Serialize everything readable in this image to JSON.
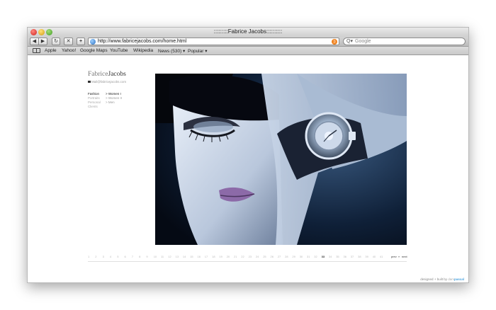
{
  "window": {
    "title": ":::::::::Fabrice Jacobs::::::::::"
  },
  "toolbar": {
    "back_glyph": "◀",
    "forward_glyph": "▶",
    "reload_glyph": "↻",
    "tabs_glyph": "✕",
    "add_glyph": "+",
    "url": "http://www.fabricejacobs.com/home.html",
    "search_placeholder": "Google",
    "search_icon": "Q▾"
  },
  "bookmarks": [
    "Apple",
    "Yahoo!",
    "Google Maps",
    "YouTube",
    "Wikipedia",
    "News (530) ▾",
    "Popular ▾"
  ],
  "site": {
    "logo_first": "Fabrice",
    "logo_second": "Jacobs",
    "email": "Mail@fabricejacobs.com",
    "nav_main": [
      "Fashion",
      "Portraits",
      "Personal",
      "Clients"
    ],
    "nav_sub": [
      "> Women I",
      "> Women II",
      "> Men"
    ],
    "pager": {
      "numbers": [
        "1",
        "2",
        "3",
        "4",
        "5",
        "6",
        "7",
        "8",
        "9",
        "10",
        "11",
        "12",
        "13",
        "14",
        "15",
        "16",
        "17",
        "18",
        "19",
        "20",
        "21",
        "22",
        "23",
        "24",
        "25",
        "26",
        "27",
        "28",
        "29",
        "30",
        "31",
        "32",
        "33",
        "34",
        "35",
        "36",
        "37",
        "38",
        "39",
        "40",
        "41"
      ],
      "current": "33",
      "prev": "prev",
      "sep": "»",
      "next": "next"
    },
    "footer": {
      "prefix": "designed + built by",
      "brand1": "dam",
      "brand2": "pascal"
    }
  },
  "colors": {
    "accent": "#4aa3df",
    "rss": "#f0821e"
  }
}
